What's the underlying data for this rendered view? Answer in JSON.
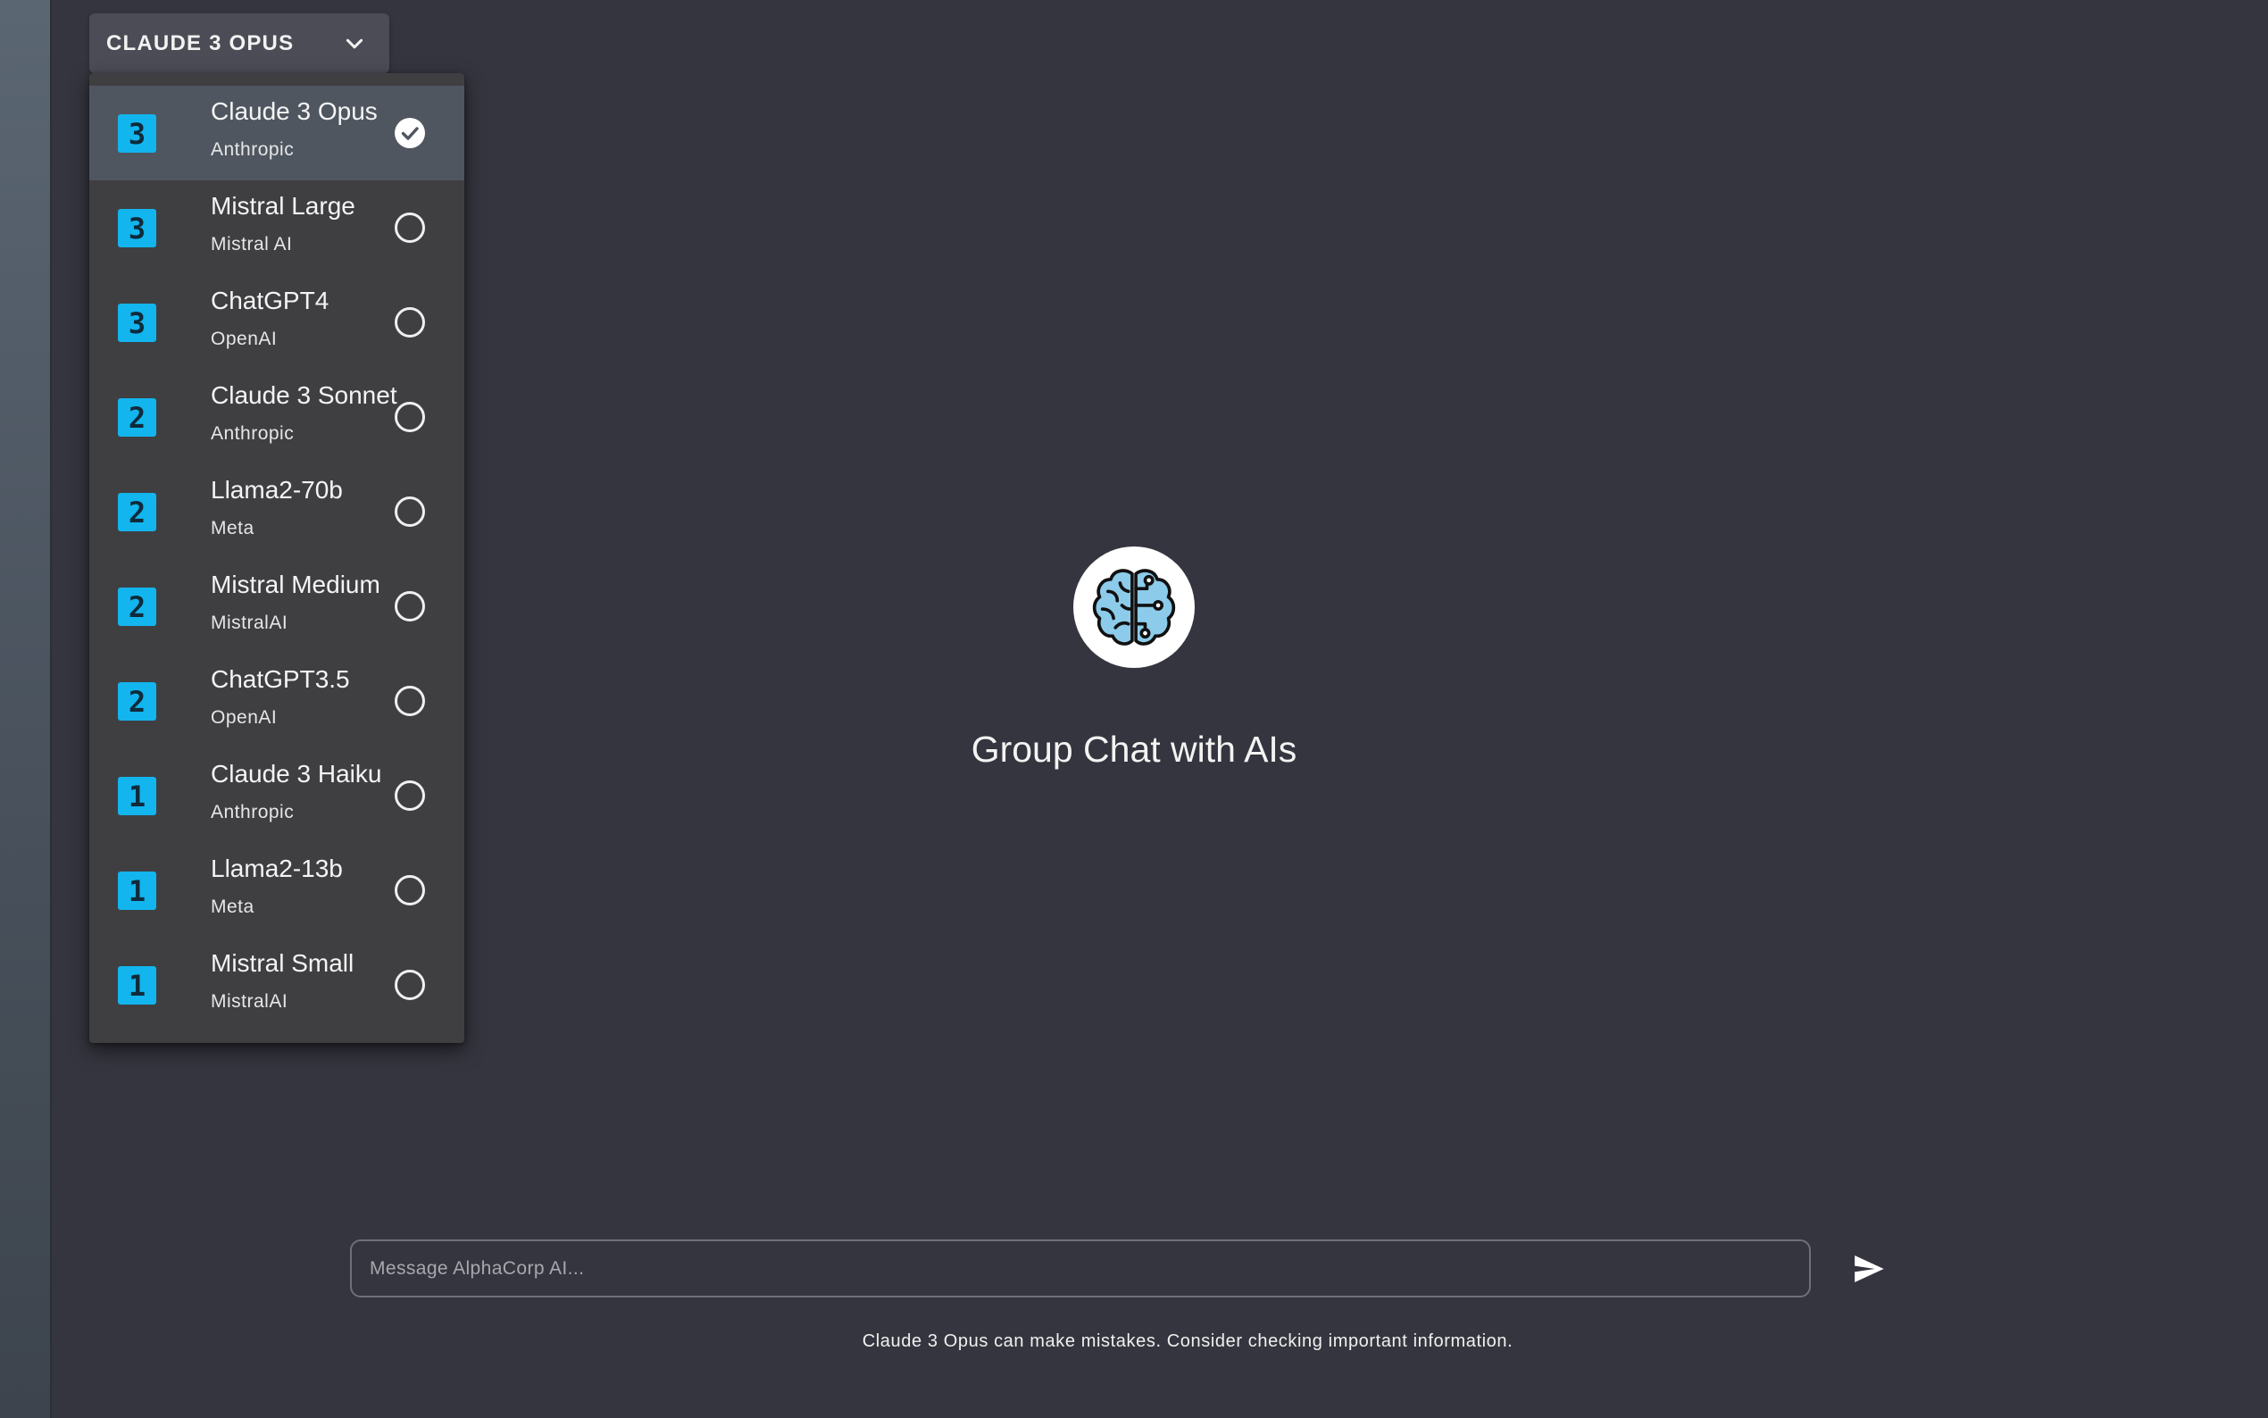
{
  "sidebar": {},
  "model_selector": {
    "label": "CLAUDE 3 OPUS",
    "icon": "chevron-down-icon"
  },
  "models": [
    {
      "tier": "3",
      "name": "Claude 3 Opus",
      "provider": "Anthropic",
      "selected": true
    },
    {
      "tier": "3",
      "name": "Mistral Large",
      "provider": "Mistral AI",
      "selected": false
    },
    {
      "tier": "3",
      "name": "ChatGPT4",
      "provider": "OpenAI",
      "selected": false
    },
    {
      "tier": "2",
      "name": "Claude 3 Sonnet",
      "provider": "Anthropic",
      "selected": false
    },
    {
      "tier": "2",
      "name": "Llama2-70b",
      "provider": "Meta",
      "selected": false
    },
    {
      "tier": "2",
      "name": "Mistral Medium",
      "provider": "MistralAI",
      "selected": false
    },
    {
      "tier": "2",
      "name": "ChatGPT3.5",
      "provider": "OpenAI",
      "selected": false
    },
    {
      "tier": "1",
      "name": "Claude 3 Haiku",
      "provider": "Anthropic",
      "selected": false
    },
    {
      "tier": "1",
      "name": "Llama2-13b",
      "provider": "Meta",
      "selected": false
    },
    {
      "tier": "1",
      "name": "Mistral Small",
      "provider": "MistralAI",
      "selected": false
    }
  ],
  "hero": {
    "icon": "brain-icon",
    "title": "Group Chat with AIs"
  },
  "composer": {
    "placeholder": "Message AlphaCorp AI...",
    "value": "",
    "send_icon": "send-icon"
  },
  "footer": {
    "disclaimer": "Claude 3 Opus can make mistakes. Consider checking important information."
  },
  "colors": {
    "background": "#35353f",
    "badge": "#12b5ee",
    "selected_row": "#4f5660",
    "brain_fill": "#8ccbea"
  }
}
